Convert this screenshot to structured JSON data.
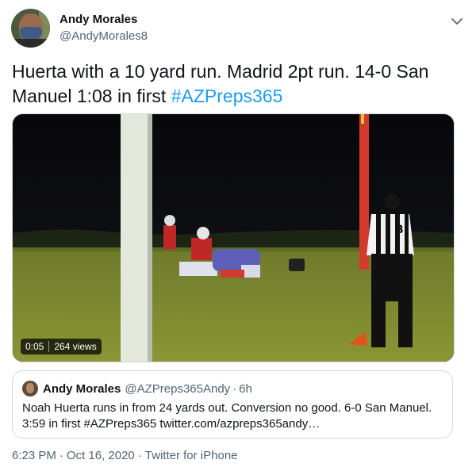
{
  "author": {
    "display_name": "Andy Morales",
    "handle": "@AndyMorales8"
  },
  "tweet": {
    "text": "Huerta with a 10 yard run. Madrid 2pt run. 14-0 San Manuel 1:08 in first ",
    "hashtag": "#AZPreps365"
  },
  "video": {
    "duration": "0:05",
    "views": "264 views"
  },
  "quoted_tweet": {
    "display_name": "Andy Morales",
    "handle": "@AZPreps365Andy",
    "separator": "·",
    "time": "6h",
    "text": "Noah Huerta runs in from 24 yards out. Conversion no good. 6-0 San Manuel. 3:59 in first #AZPreps365 twitter.com/azpreps365andy…"
  },
  "meta": {
    "time": "6:23 PM",
    "date": "Oct 16, 2020",
    "source": "Twitter for iPhone",
    "separator": "·"
  },
  "colors": {
    "link": "#1d9bf0",
    "secondary_text": "#536471",
    "border": "#cfd9de"
  },
  "icons": {
    "more": "chevron-down-icon"
  }
}
